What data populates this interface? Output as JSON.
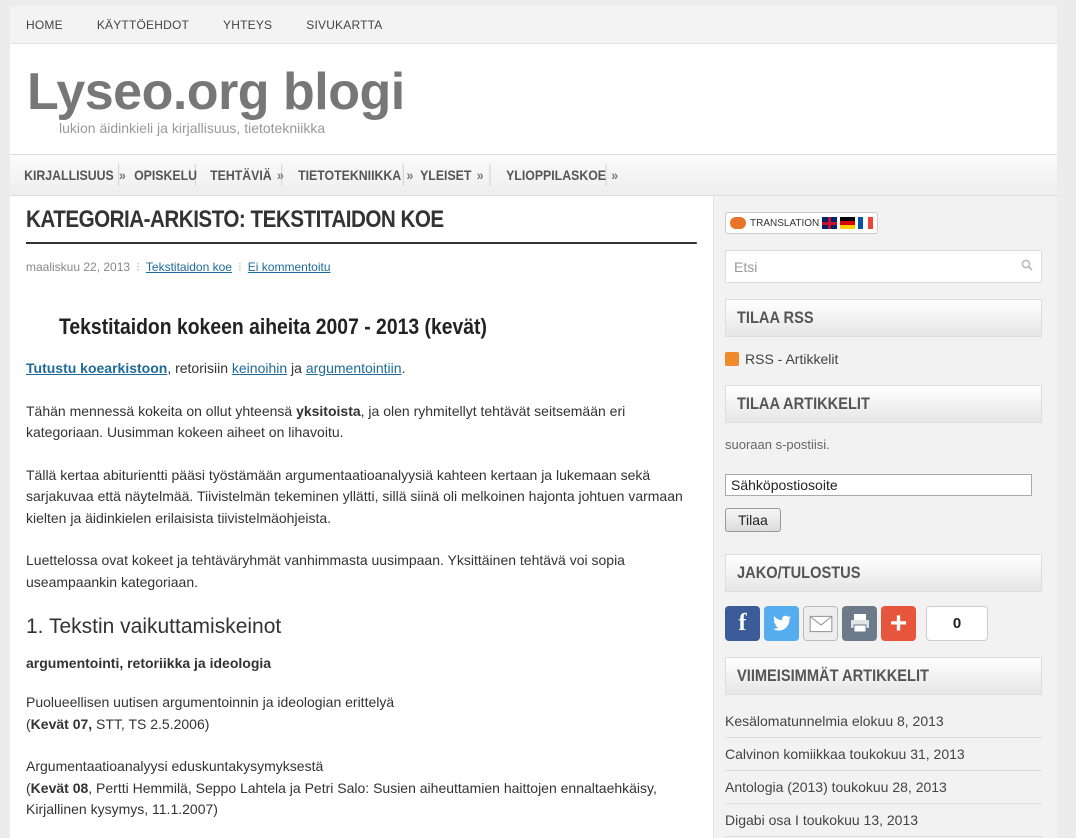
{
  "topnav": [
    "HOME",
    "KÄYTTÖEHDOT",
    "YHTEYS",
    "SIVUKARTTA"
  ],
  "header": {
    "title": "Lyseo.org blogi",
    "tagline": "lukion äidinkieli ja kirjallisuus, tietotekniikka"
  },
  "mainnav": [
    {
      "label": "KIRJALLISUUS",
      "arrow": "»"
    },
    {
      "label": "OPISKELU",
      "arrow": ""
    },
    {
      "label": "TEHTÄVIÄ",
      "arrow": "»"
    },
    {
      "label": "TIETOTEKNIIKKA",
      "arrow": "»"
    },
    {
      "label": "YLEISET",
      "arrow": "»"
    },
    {
      "label": "YLIOPPILASKOE",
      "arrow": "»"
    }
  ],
  "content": {
    "category_title": "KATEGORIA-ARKISTO: TEKSTITAIDON KOE",
    "meta": {
      "date": "maaliskuu 22, 2013",
      "category": "Tekstitaidon koe",
      "comments": "Ei kommentoitu"
    },
    "post_title": "Tekstitaidon kokeen aiheita 2007 - 2013 (kevät)",
    "p1": {
      "link1": "Tutustu koearkistoon",
      "t1": ", retorisiin ",
      "link2": "keinoihin",
      "t2": " ja ",
      "link3": "argumentointiin",
      "t3": "."
    },
    "p2": {
      "a": "Tähän mennessä kokeita on ollut yhteensä ",
      "b": "yksitoista",
      "c": ", ja olen ryhmitellyt tehtävät seitsemään eri kategoriaan. Uusimman kokeen aiheet on lihavoitu."
    },
    "p3": "Tällä kertaa abiturientti pääsi työstämään argumentaatioanalyysiä kahteen kertaan ja lukemaan sekä sarjakuvaa että näytelmää. Tiivistelmän tekeminen yllätti, sillä siinä oli melkoinen hajonta johtuen varmaan kielten ja äidinkielen erilaisista tiivistelmäohjeista.",
    "p4": "Luettelossa ovat kokeet ja tehtäväryhmät vanhimmasta uusimpaan. Yksittäinen tehtävä voi sopia useampaankin kategoriaan.",
    "h2": "1. Tekstin vaikuttamiskeinot",
    "subh": "argumentointi, retoriikka ja ideologia",
    "item1": {
      "line1": "Puolueellisen uutisen argumentoinnin ja ideologian erittelyä",
      "open": "(",
      "bold": "Kevät 07,",
      "rest": " STT, TS 2.5.2006)"
    },
    "item2": {
      "line1": "Argumentaatioanalyysi eduskuntakysymyksestä",
      "open": "(",
      "bold": "Kevät 08",
      "rest": ", Pertti Hemmilä, Seppo Lahtela ja Petri Salo: Susien aiheuttamien haittojen ennaltaehkäisy, Kirjallinen kysymys, 11.1.2007)"
    }
  },
  "sidebar": {
    "translation_label": "TRANSLATION",
    "search_placeholder": "Etsi",
    "rss_title": "TILAA RSS",
    "rss_link": "RSS - Artikkelit",
    "articles_title": "TILAA ARTIKKELIT",
    "articles_text": "suoraan s-postiisi.",
    "email_value": "Sähköpostiosoite",
    "subscribe_button": "Tilaa",
    "share_title": "JAKO/TULOSTUS",
    "share_count": "0",
    "share_icons": [
      "facebook-icon",
      "twitter-icon",
      "email-icon",
      "print-icon",
      "more-icon"
    ],
    "recent_title": "VIIMEISIMMÄT ARTIKKELIT",
    "recent": [
      "Kesälomatunnelmia elokuu 8, 2013",
      "Calvinon komiikkaa toukokuu 31, 2013",
      "Antologia (2013) toukokuu 28, 2013",
      "Digabi osa I toukokuu 13, 2013"
    ]
  },
  "colors": {
    "link": "#1e6b9a",
    "facebook": "#3b5b99",
    "twitter": "#55acee",
    "more": "#e8553d"
  }
}
